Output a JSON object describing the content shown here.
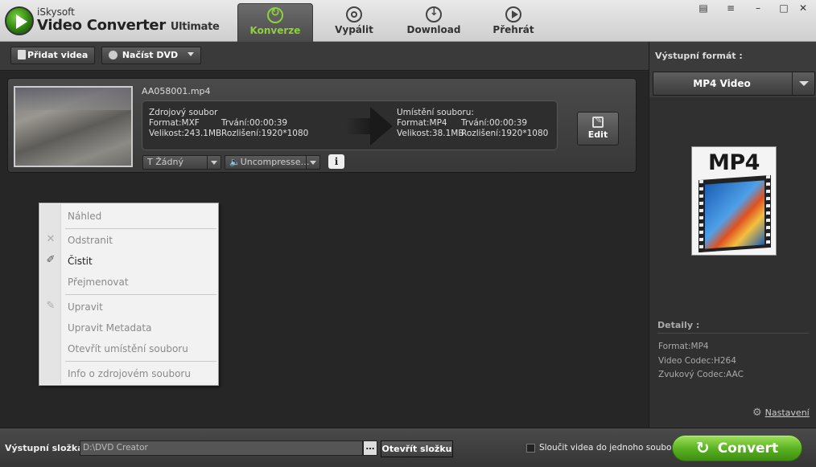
{
  "app": {
    "brand_top": "iSkysoft",
    "brand_main": "Video Converter",
    "brand_suffix": "Ultimate"
  },
  "nav": {
    "tabs": [
      {
        "label": "Konverze",
        "icon": "convert-icon",
        "active": true
      },
      {
        "label": "Vypálit",
        "icon": "disc-icon",
        "active": false
      },
      {
        "label": "Download",
        "icon": "download-icon",
        "active": false
      },
      {
        "label": "Přehrát",
        "icon": "play-icon",
        "active": false
      }
    ]
  },
  "toolbar": {
    "add_videos": "Přidat videa",
    "load_dvd": "Načíst DVD"
  },
  "file": {
    "name": "AA058001.mp4",
    "source": {
      "title": "Zdrojový soubor",
      "format": "Format:MXF",
      "size": "Velikost:243.1MB",
      "duration": "Trvání:00:00:39",
      "resolution": "Rozlišení:1920*1080"
    },
    "dest": {
      "title": "Umístění souboru:",
      "format": "Format:MP4",
      "size": "Velikost:38.1MB",
      "duration": "Trvání:00:00:39",
      "resolution": "Rozlišení:1920*1080"
    },
    "edit_label": "Edit",
    "subtitle_select": "T Žádný",
    "audio_select": "🔈Uncompresse…",
    "info_label": "i"
  },
  "context_menu": {
    "items": [
      {
        "label": "Náhled",
        "enabled": false
      },
      {
        "label": "Odstranit",
        "enabled": false,
        "icon": "delete-icon"
      },
      {
        "label": "Čistit",
        "enabled": true,
        "icon": "broom-icon"
      },
      {
        "label": "Přejmenovat",
        "enabled": false
      },
      {
        "label": "Upravit",
        "enabled": false,
        "icon": "pencil-icon"
      },
      {
        "label": "Upravit Metadata",
        "enabled": false
      },
      {
        "label": "Otevřít umístění souboru",
        "enabled": false
      },
      {
        "label": "Info o zdrojovém souboru",
        "enabled": false
      }
    ]
  },
  "output_panel": {
    "title": "Výstupní formát :",
    "selected_format": "MP4 Video",
    "card_label": "MP4",
    "details_title": "Detaily :",
    "details": [
      "Format:MP4",
      "Video Codec:H264",
      "Zvukový Codec:AAC"
    ],
    "settings_label": "Nastavení"
  },
  "bottom": {
    "output_folder_label": "Výstupní složka",
    "output_path": "D:\\DVD Creator",
    "browse_label": "…",
    "open_folder_label": "Otevřít složku",
    "merge_label": "Sloučit videa do jednoho souboru",
    "merge_checked": false,
    "convert_label": "Convert"
  },
  "colors": {
    "accent_green": "#8ed13c",
    "convert_green": "#58b020"
  }
}
